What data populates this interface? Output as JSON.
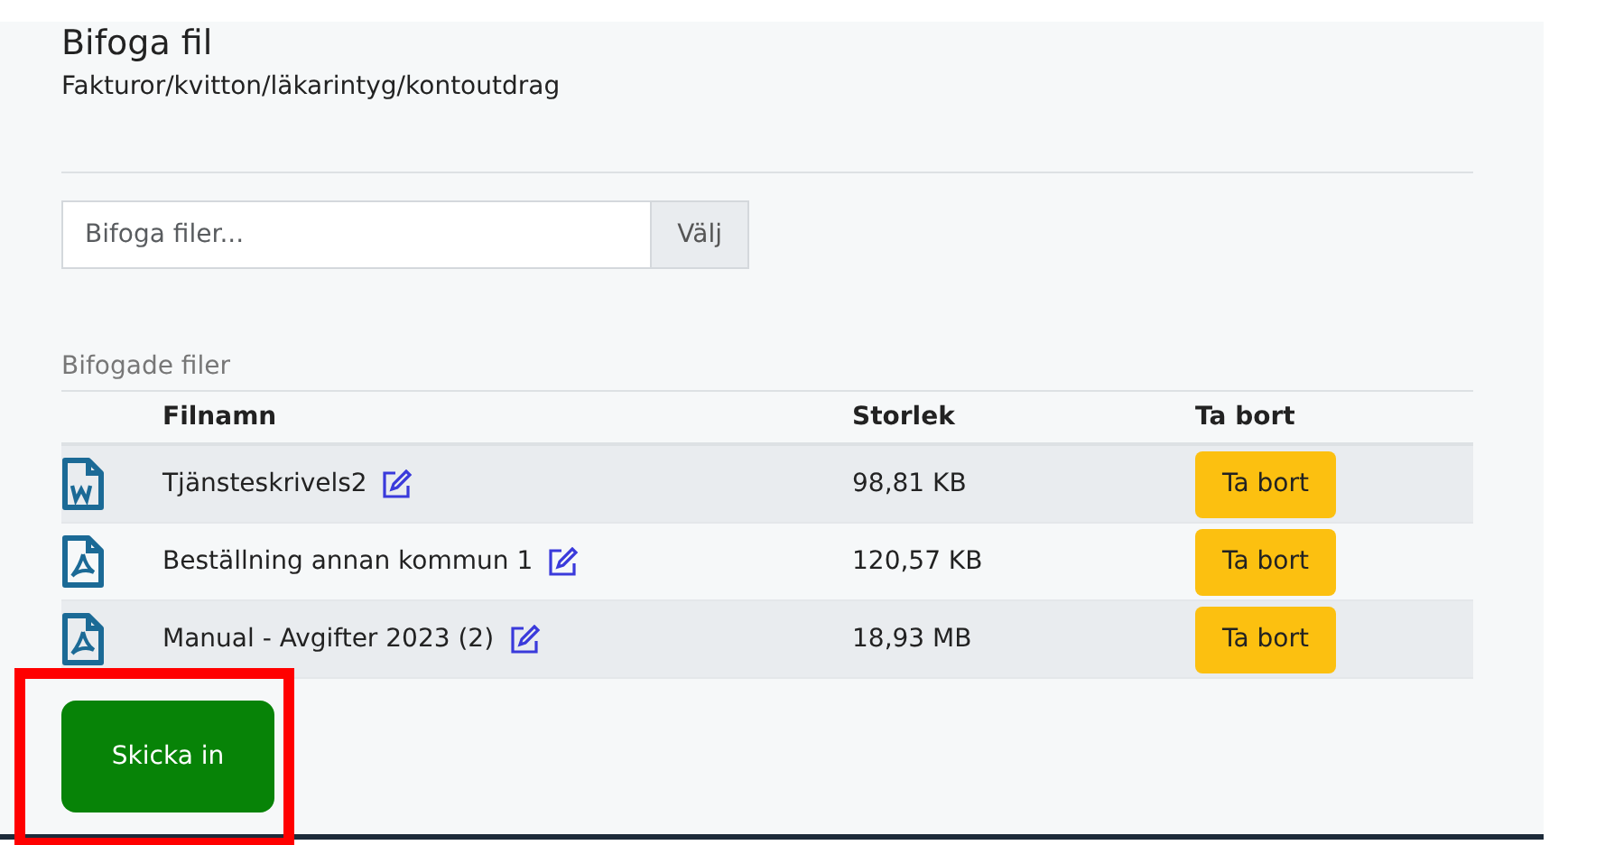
{
  "heading": "Bifoga fil",
  "subheading": "Fakturor/kvitton/läkarintyg/kontoutdrag",
  "file_input": {
    "placeholder": "Bifoga filer...",
    "button": "Välj"
  },
  "attached": {
    "label": "Bifogade filer",
    "columns": [
      "Filnamn",
      "Storlek",
      "Ta bort"
    ],
    "rows": [
      {
        "kind": "word",
        "name": "Tjänsteskrivels2",
        "size": "98,81 KB",
        "remove": "Ta bort"
      },
      {
        "kind": "pdf",
        "name": "Beställning annan kommun 1",
        "size": "120,57 KB",
        "remove": "Ta bort"
      },
      {
        "kind": "pdf",
        "name": "Manual - Avgifter 2023 (2)",
        "size": "18,93 MB",
        "remove": "Ta bort"
      }
    ]
  },
  "submit": "Skicka in"
}
